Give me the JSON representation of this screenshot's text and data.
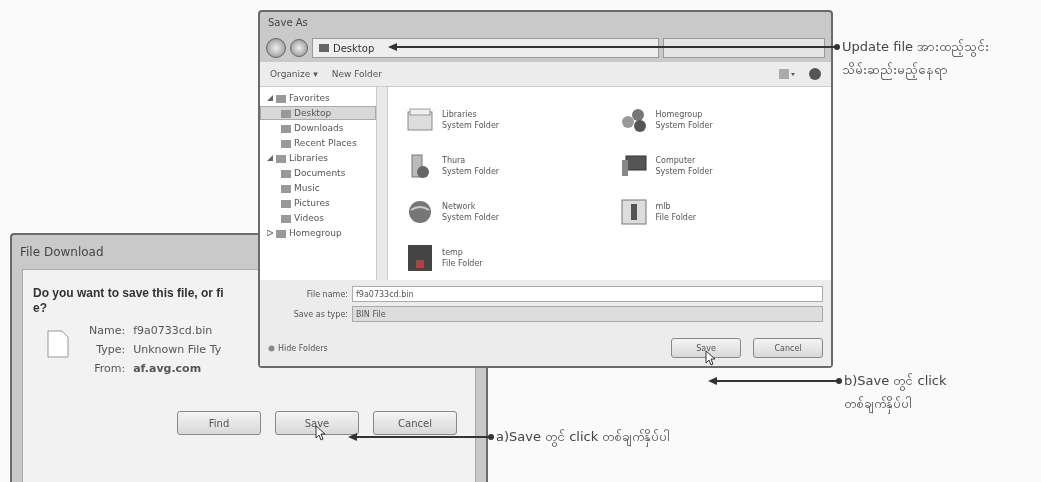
{
  "save_as": {
    "title": "Save As",
    "address": "Desktop",
    "toolbar": [
      "Organize ▾",
      "New Folder"
    ],
    "nav": [
      {
        "label": "Favorites",
        "expanded": true,
        "selected": false,
        "children": [
          {
            "label": "Desktop",
            "selected": true
          },
          {
            "label": "Downloads",
            "selected": false
          },
          {
            "label": "Recent Places",
            "selected": false
          }
        ]
      },
      {
        "label": "Libraries",
        "expanded": true,
        "selected": false,
        "children": [
          {
            "label": "Documents",
            "selected": false
          },
          {
            "label": "Music",
            "selected": false
          },
          {
            "label": "Pictures",
            "selected": false
          },
          {
            "label": "Videos",
            "selected": false
          }
        ]
      },
      {
        "label": "Homegroup",
        "expanded": false,
        "selected": false
      }
    ],
    "items": [
      {
        "name": "Libraries",
        "type": "System Folder"
      },
      {
        "name": "Homegroup",
        "type": "System Folder"
      },
      {
        "name": "Thura",
        "type": "System Folder"
      },
      {
        "name": "Computer",
        "type": "System Folder"
      },
      {
        "name": "Network",
        "type": "System Folder"
      },
      {
        "name": "mlb",
        "type": "File Folder"
      },
      {
        "name": "temp",
        "type": "File Folder"
      }
    ],
    "file_name_label": "File name:",
    "file_name": "f9a0733cd.bin",
    "type_label": "Save as type:",
    "type": "BIN File",
    "hide_folders": "Hide Folders",
    "buttons": [
      "Save",
      "Cancel"
    ]
  },
  "file_download": {
    "title": "File Download",
    "question": "Do you want to save this file, or fi",
    "question_line_2": "e?",
    "details": [
      {
        "label": "Name:",
        "value": "f9a0733cd.bin"
      },
      {
        "label": "Type:",
        "value": "Unknown File Ty"
      },
      {
        "label": "From:",
        "value": "af.avg.com"
      }
    ],
    "buttons": [
      "Find",
      "Save",
      "Cancel"
    ]
  },
  "callouts": [
    {
      "lines": [
        "Update file အားထည့်သွင်း",
        "သိမ်းဆည်းမည့်နေရာ"
      ]
    },
    {
      "lines": [
        "b)Save တွင် click",
        "တစ်ချက်နှိပ်ပါ"
      ]
    },
    {
      "lines": [
        "a)Save တွင် click တစ်ချက်နှိပ်ပါ"
      ]
    }
  ]
}
